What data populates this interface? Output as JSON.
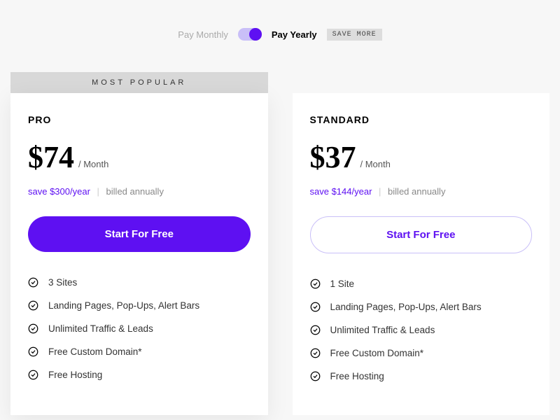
{
  "billing": {
    "monthly_label": "Pay Monthly",
    "yearly_label": "Pay Yearly",
    "save_more": "SAVE MORE"
  },
  "popular_ribbon": "MOST POPULAR",
  "plans": {
    "pro": {
      "name": "PRO",
      "price": "$74",
      "per": "/ Month",
      "save": "save $300/year",
      "billed": "billed annually",
      "cta": "Start For Free",
      "features": [
        "3 Sites",
        "Landing Pages, Pop-Ups, Alert Bars",
        "Unlimited Traffic & Leads",
        "Free Custom Domain*",
        "Free Hosting"
      ]
    },
    "standard": {
      "name": "STANDARD",
      "price": "$37",
      "per": "/ Month",
      "save": "save $144/year",
      "billed": "billed annually",
      "cta": "Start For Free",
      "features": [
        "1 Site",
        "Landing Pages, Pop-Ups, Alert Bars",
        "Unlimited Traffic & Leads",
        "Free Custom Domain*",
        "Free Hosting"
      ]
    }
  }
}
